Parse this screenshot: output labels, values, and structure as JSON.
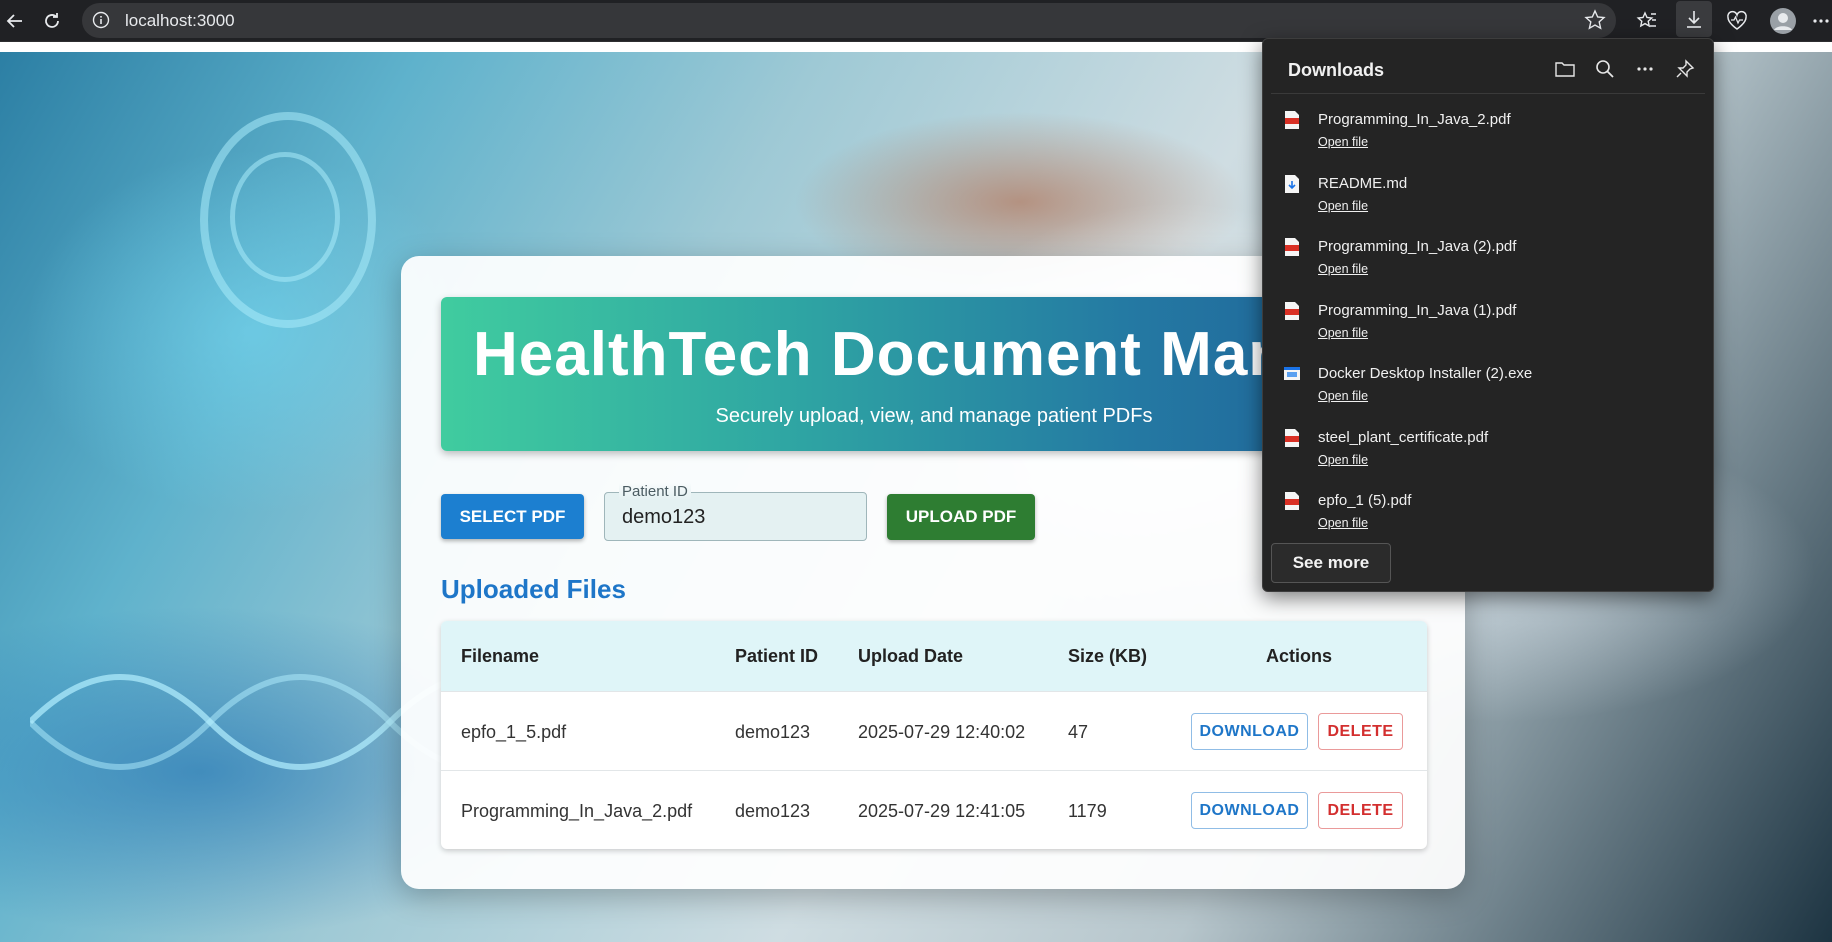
{
  "browser": {
    "url": "localhost:3000"
  },
  "app": {
    "title": "HealthTech Document Man",
    "subtitle": "Securely upload, view, and manage patient PDFs",
    "select_pdf_label": "SELECT PDF",
    "patient_id_label": "Patient ID",
    "patient_id_value": "demo123",
    "upload_pdf_label": "UPLOAD PDF",
    "uploaded_files_title": "Uploaded Files",
    "table": {
      "headers": [
        "Filename",
        "Patient ID",
        "Upload Date",
        "Size (KB)",
        "Actions"
      ],
      "rows": [
        {
          "filename": "epfo_1_5.pdf",
          "patient_id": "demo123",
          "upload_date": "2025-07-29 12:40:02",
          "size_kb": "47",
          "download_label": "DOWNLOAD",
          "delete_label": "DELETE"
        },
        {
          "filename": "Programming_In_Java_2.pdf",
          "patient_id": "demo123",
          "upload_date": "2025-07-29 12:41:05",
          "size_kb": "1179",
          "download_label": "DOWNLOAD",
          "delete_label": "DELETE"
        }
      ]
    }
  },
  "downloads": {
    "title": "Downloads",
    "open_file_label": "Open file",
    "see_more_label": "See more",
    "items": [
      {
        "name": "Programming_In_Java_2.pdf",
        "icon": "pdf-file-icon"
      },
      {
        "name": "README.md",
        "icon": "markdown-file-icon"
      },
      {
        "name": "Programming_In_Java (2).pdf",
        "icon": "pdf-file-icon"
      },
      {
        "name": "Programming_In_Java (1).pdf",
        "icon": "pdf-file-icon"
      },
      {
        "name": "Docker Desktop Installer (2).exe",
        "icon": "exe-file-icon"
      },
      {
        "name": "steel_plant_certificate.pdf",
        "icon": "pdf-file-icon"
      },
      {
        "name": "epfo_1 (5).pdf",
        "icon": "pdf-file-icon"
      }
    ]
  },
  "colors": {
    "primary_blue": "#1c7fd0",
    "upload_green": "#2e7d32",
    "delete_red": "#d32f2f",
    "section_blue": "#1e76c8",
    "banner_start": "#40cc9f",
    "banner_end": "#1f5f96"
  }
}
